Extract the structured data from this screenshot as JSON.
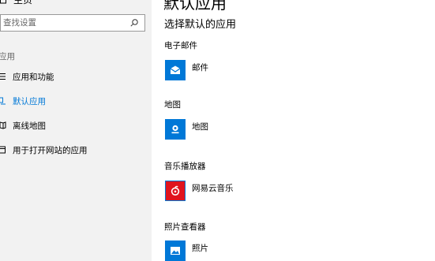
{
  "sidebar": {
    "home_label": "主页",
    "search": {
      "placeholder": "查找设置",
      "value": ""
    },
    "section_label": "应用",
    "items": [
      {
        "label": "应用和功能",
        "icon": "apps-list-icon",
        "active": false
      },
      {
        "label": "默认应用",
        "icon": "default-apps-icon",
        "active": true
      },
      {
        "label": "离线地图",
        "icon": "offline-maps-icon",
        "active": false
      },
      {
        "label": "用于打开网站的应用",
        "icon": "apps-for-websites-icon",
        "active": false
      }
    ]
  },
  "main": {
    "title": "默认应用",
    "subtitle": "选择默认的应用",
    "categories": [
      {
        "label": "电子邮件",
        "app": {
          "name": "邮件",
          "icon": "mail-icon",
          "tile_color": "#0078d7"
        }
      },
      {
        "label": "地图",
        "app": {
          "name": "地图",
          "icon": "maps-icon",
          "tile_color": "#0078d7"
        }
      },
      {
        "label": "音乐播放器",
        "app": {
          "name": "网易云音乐",
          "icon": "netease-music-icon",
          "tile_color": "#e0141e"
        }
      },
      {
        "label": "照片查看器",
        "app": {
          "name": "照片",
          "icon": "photos-icon",
          "tile_color": "#0078d7"
        }
      }
    ]
  },
  "colors": {
    "accent": "#0078d7",
    "sidebar_bg": "#f2f2f2",
    "secondary_text": "#666666"
  }
}
